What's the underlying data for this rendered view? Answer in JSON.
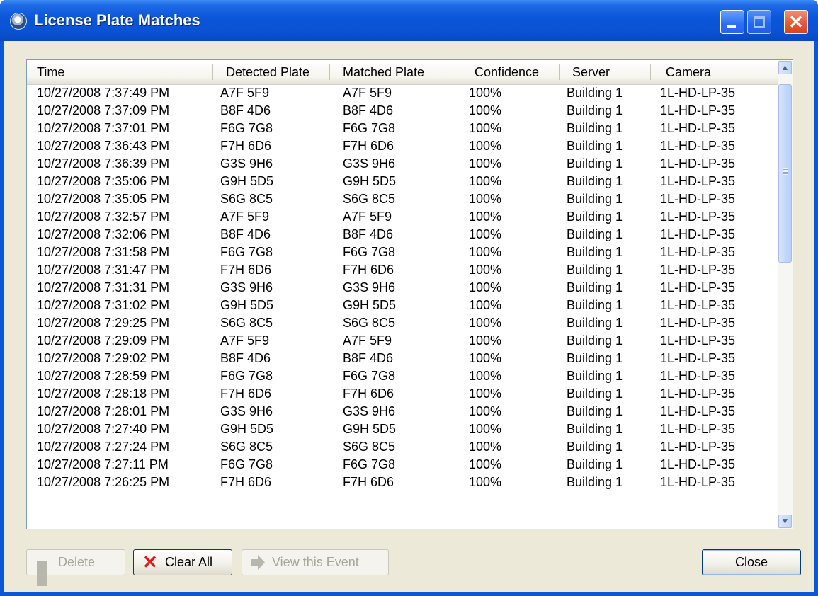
{
  "window": {
    "title": "License Plate Matches",
    "icon": "app-icon",
    "controls": {
      "minimize": "minimize-icon",
      "maximize": "maximize-icon",
      "close": "close-icon"
    }
  },
  "table": {
    "columns": [
      "Time",
      "Detected Plate",
      "Matched Plate",
      "Confidence",
      "Server",
      "Camera"
    ],
    "rows": [
      [
        "10/27/2008 7:37:49 PM",
        "A7F 5F9",
        "A7F 5F9",
        "100%",
        "Building 1",
        "1L-HD-LP-35"
      ],
      [
        "10/27/2008 7:37:09 PM",
        "B8F 4D6",
        "B8F 4D6",
        "100%",
        "Building 1",
        "1L-HD-LP-35"
      ],
      [
        "10/27/2008 7:37:01 PM",
        "F6G 7G8",
        "F6G 7G8",
        "100%",
        "Building 1",
        "1L-HD-LP-35"
      ],
      [
        "10/27/2008 7:36:43 PM",
        "F7H 6D6",
        "F7H 6D6",
        "100%",
        "Building 1",
        "1L-HD-LP-35"
      ],
      [
        "10/27/2008 7:36:39 PM",
        "G3S 9H6",
        "G3S 9H6",
        "100%",
        "Building 1",
        "1L-HD-LP-35"
      ],
      [
        "10/27/2008 7:35:06 PM",
        "G9H 5D5",
        "G9H 5D5",
        "100%",
        "Building 1",
        "1L-HD-LP-35"
      ],
      [
        "10/27/2008 7:35:05 PM",
        "S6G 8C5",
        "S6G 8C5",
        "100%",
        "Building 1",
        "1L-HD-LP-35"
      ],
      [
        "10/27/2008 7:32:57 PM",
        "A7F 5F9",
        "A7F 5F9",
        "100%",
        "Building 1",
        "1L-HD-LP-35"
      ],
      [
        "10/27/2008 7:32:06 PM",
        "B8F 4D6",
        "B8F 4D6",
        "100%",
        "Building 1",
        "1L-HD-LP-35"
      ],
      [
        "10/27/2008 7:31:58 PM",
        "F6G 7G8",
        "F6G 7G8",
        "100%",
        "Building 1",
        "1L-HD-LP-35"
      ],
      [
        "10/27/2008 7:31:47 PM",
        "F7H 6D6",
        "F7H 6D6",
        "100%",
        "Building 1",
        "1L-HD-LP-35"
      ],
      [
        "10/27/2008 7:31:31 PM",
        "G3S 9H6",
        "G3S 9H6",
        "100%",
        "Building 1",
        "1L-HD-LP-35"
      ],
      [
        "10/27/2008 7:31:02 PM",
        "G9H 5D5",
        "G9H 5D5",
        "100%",
        "Building 1",
        "1L-HD-LP-35"
      ],
      [
        "10/27/2008 7:29:25 PM",
        "S6G 8C5",
        "S6G 8C5",
        "100%",
        "Building 1",
        "1L-HD-LP-35"
      ],
      [
        "10/27/2008 7:29:09 PM",
        "A7F 5F9",
        "A7F 5F9",
        "100%",
        "Building 1",
        "1L-HD-LP-35"
      ],
      [
        "10/27/2008 7:29:02 PM",
        "B8F 4D6",
        "B8F 4D6",
        "100%",
        "Building 1",
        "1L-HD-LP-35"
      ],
      [
        "10/27/2008 7:28:59 PM",
        "F6G 7G8",
        "F6G 7G8",
        "100%",
        "Building 1",
        "1L-HD-LP-35"
      ],
      [
        "10/27/2008 7:28:18 PM",
        "F7H 6D6",
        "F7H 6D6",
        "100%",
        "Building 1",
        "1L-HD-LP-35"
      ],
      [
        "10/27/2008 7:28:01 PM",
        "G3S 9H6",
        "G3S 9H6",
        "100%",
        "Building 1",
        "1L-HD-LP-35"
      ],
      [
        "10/27/2008 7:27:40 PM",
        "G9H 5D5",
        "G9H 5D5",
        "100%",
        "Building 1",
        "1L-HD-LP-35"
      ],
      [
        "10/27/2008 7:27:24 PM",
        "S6G 8C5",
        "S6G 8C5",
        "100%",
        "Building 1",
        "1L-HD-LP-35"
      ],
      [
        "10/27/2008 7:27:11 PM",
        "F6G 7G8",
        "F6G 7G8",
        "100%",
        "Building 1",
        "1L-HD-LP-35"
      ],
      [
        "10/27/2008 7:26:25 PM",
        "F7H 6D6",
        "F7H 6D6",
        "100%",
        "Building 1",
        "1L-HD-LP-35"
      ]
    ]
  },
  "buttons": {
    "delete": {
      "label": "Delete",
      "enabled": false,
      "icon": "minus-icon"
    },
    "clear_all": {
      "label": "Clear All",
      "enabled": true,
      "icon": "red-x-icon"
    },
    "view_event": {
      "label": "View this Event",
      "enabled": false,
      "icon": "arrow-right-icon"
    },
    "close": {
      "label": "Close",
      "enabled": true
    }
  },
  "colors": {
    "titlebar": "#0a55d8",
    "client": "#ece9d8",
    "close_button": "#e35a3a",
    "clear_icon": "#e11b1b"
  }
}
